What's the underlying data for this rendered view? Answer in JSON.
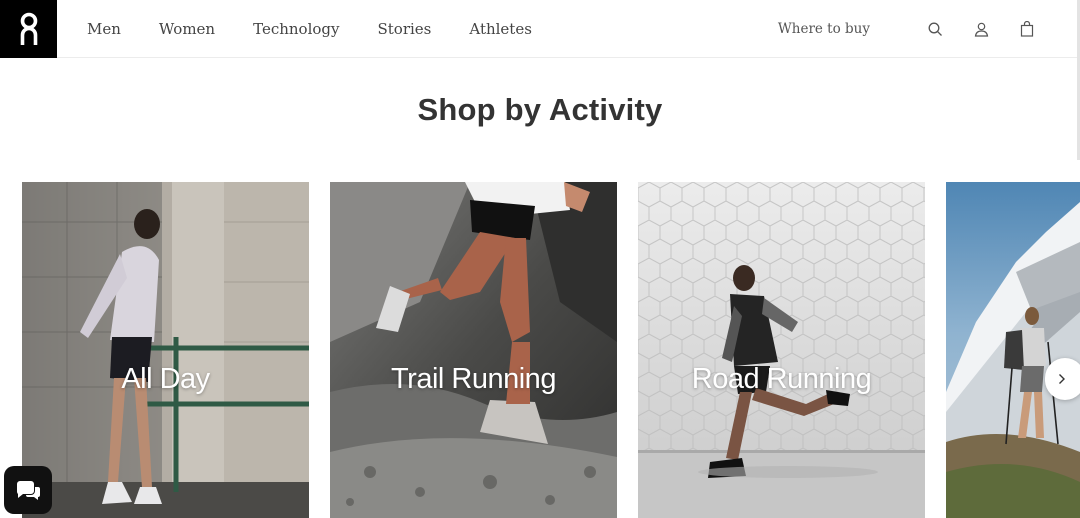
{
  "header": {
    "logo_icon": "on-logo-icon",
    "nav": [
      {
        "label": "Men"
      },
      {
        "label": "Women"
      },
      {
        "label": "Technology"
      },
      {
        "label": "Stories"
      },
      {
        "label": "Athletes"
      }
    ],
    "where_to_buy": "Where to buy",
    "icons": [
      "search-icon",
      "account-icon",
      "bag-icon"
    ]
  },
  "main": {
    "section_title": "Shop by Activity",
    "cards": [
      {
        "label": "All Day"
      },
      {
        "label": "Trail Running"
      },
      {
        "label": "Road Running"
      },
      {
        "label": ""
      }
    ],
    "next_icon": "chevron-right-icon",
    "chat_icon": "chat-icon"
  },
  "colors": {
    "logo_bg": "#000000",
    "text": "#333333",
    "nav_text": "#444444"
  }
}
